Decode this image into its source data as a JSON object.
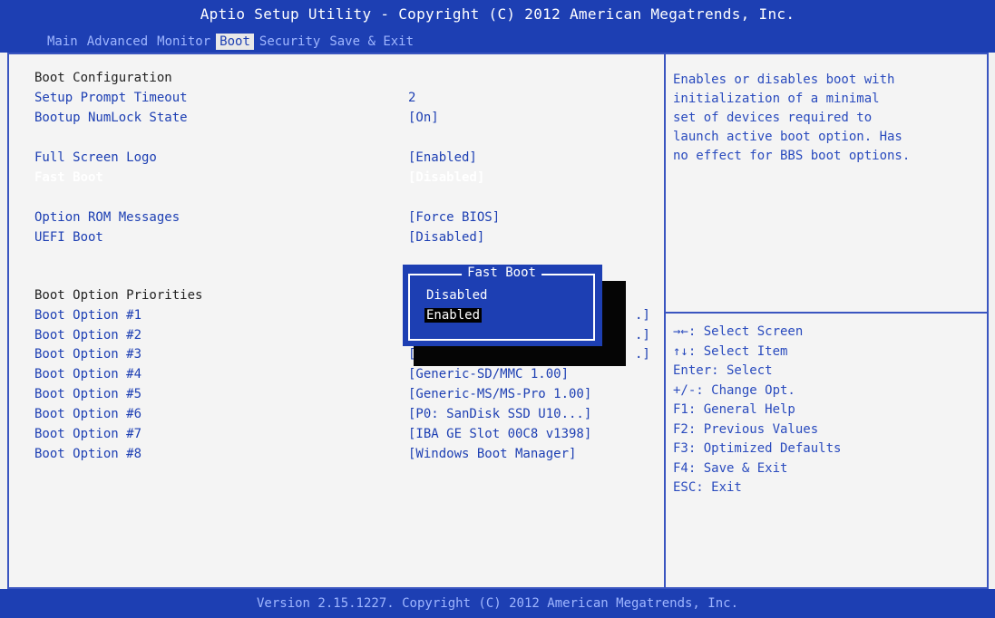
{
  "header": {
    "title": "Aptio Setup Utility - Copyright (C) 2012 American Megatrends, Inc.",
    "tabs": [
      "Main",
      "Advanced",
      "Monitor",
      "Boot",
      "Security",
      "Save & Exit"
    ],
    "active_tab": "Boot"
  },
  "boot_config": {
    "heading": "Boot Configuration",
    "setup_prompt_timeout_label": "Setup Prompt Timeout",
    "setup_prompt_timeout_value": "2",
    "bootup_numlock_label": "Bootup NumLock State",
    "bootup_numlock_value": "[On]",
    "full_screen_logo_label": "Full Screen Logo",
    "full_screen_logo_value": "[Enabled]",
    "fast_boot_label": "Fast Boot",
    "fast_boot_value": "[Disabled]",
    "option_rom_label": "Option ROM Messages",
    "option_rom_value": "[Force BIOS]",
    "uefi_boot_label": "UEFI Boot",
    "uefi_boot_value": "[Disabled]"
  },
  "boot_priorities": {
    "heading": "Boot Option Priorities",
    "options": [
      {
        "label": "Boot Option #1",
        "value": ".]"
      },
      {
        "label": "Boot Option #2",
        "value": ".]"
      },
      {
        "label": "Boot Option #3",
        "value": "[G"
      },
      {
        "label": "Boot Option #4",
        "value": "[Generic-SD/MMC 1.00]"
      },
      {
        "label": "Boot Option #5",
        "value": "[Generic-MS/MS-Pro 1.00]"
      },
      {
        "label": "Boot Option #6",
        "value": "[P0: SanDisk SSD U10...]"
      },
      {
        "label": "Boot Option #7",
        "value": "[IBA GE Slot 00C8 v1398]"
      },
      {
        "label": "Boot Option #8",
        "value": "[Windows Boot Manager]"
      }
    ],
    "option3_suffix": ".]"
  },
  "popup": {
    "title": "Fast Boot",
    "options": [
      "Disabled",
      "Enabled"
    ],
    "selected": "Enabled"
  },
  "help": {
    "description": "Enables or disables boot with\ninitialization of a minimal\nset of devices required to\nlaunch active boot option. Has\nno effect for BBS boot options.",
    "keys": [
      "→←: Select Screen",
      "↑↓: Select Item",
      "Enter: Select",
      "+/-: Change Opt.",
      "F1: General Help",
      "F2: Previous Values",
      "F3: Optimized Defaults",
      "F4: Save & Exit",
      "ESC: Exit"
    ]
  },
  "footer": {
    "text": "Version 2.15.1227. Copyright (C) 2012 American Megatrends, Inc."
  },
  "colors": {
    "bios_blue": "#1d3fb3",
    "panel_bg": "#f4f4f4",
    "highlight_text": "#ffffff"
  }
}
